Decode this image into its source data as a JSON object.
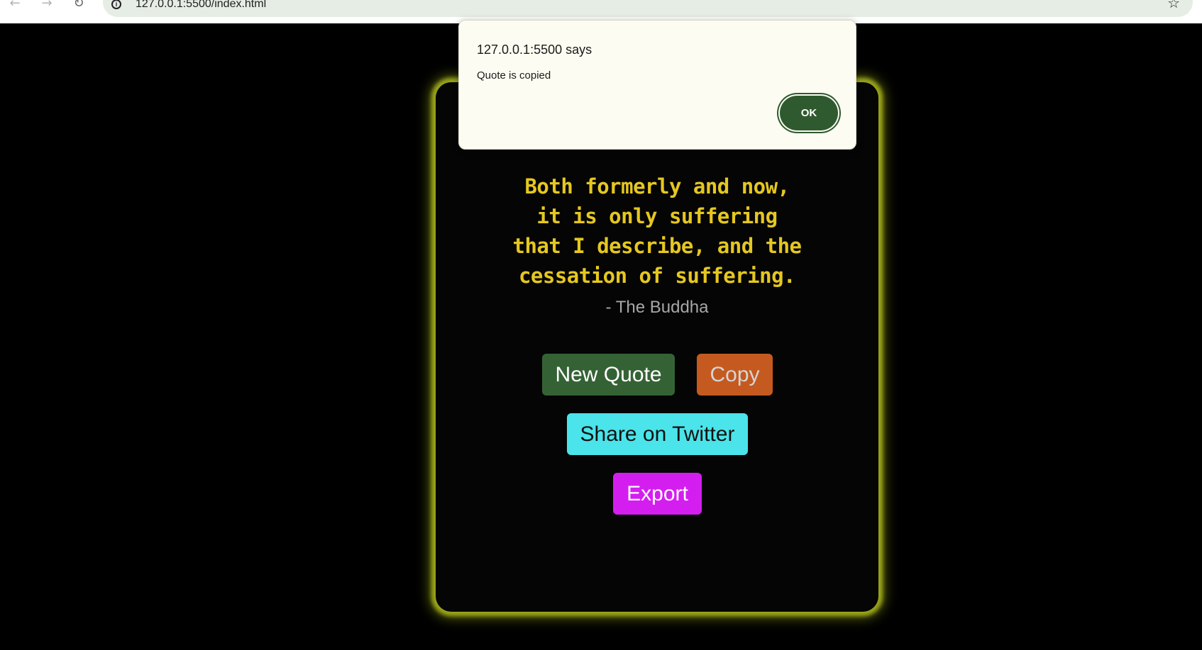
{
  "browser": {
    "back_icon": "←",
    "forward_icon": "→",
    "reload_icon": "↻",
    "info_icon": "i",
    "url": "127.0.0.1:5500/index.html",
    "bookmark_icon": "☆"
  },
  "quote": {
    "text": "Both formerly and now, it is only suffering that I describe, and the cessation of suffering.",
    "author": "- The Buddha"
  },
  "buttons": {
    "new_quote": "New Quote",
    "copy": "Copy",
    "share_twitter": "Share on Twitter",
    "export": "Export"
  },
  "alert": {
    "title": "127.0.0.1:5500 says",
    "message": "Quote is copied",
    "ok_label": "OK"
  },
  "colors": {
    "background": "#000000",
    "card_glow": "#c8d21e",
    "quote_text": "#e5c720",
    "author_text": "#a7a7a7",
    "new_quote_button": "#356235",
    "copy_button": "#c55a20",
    "twitter_button": "#4ae4ea",
    "export_button": "#d41ef0",
    "ok_button": "#2f5a2f"
  }
}
